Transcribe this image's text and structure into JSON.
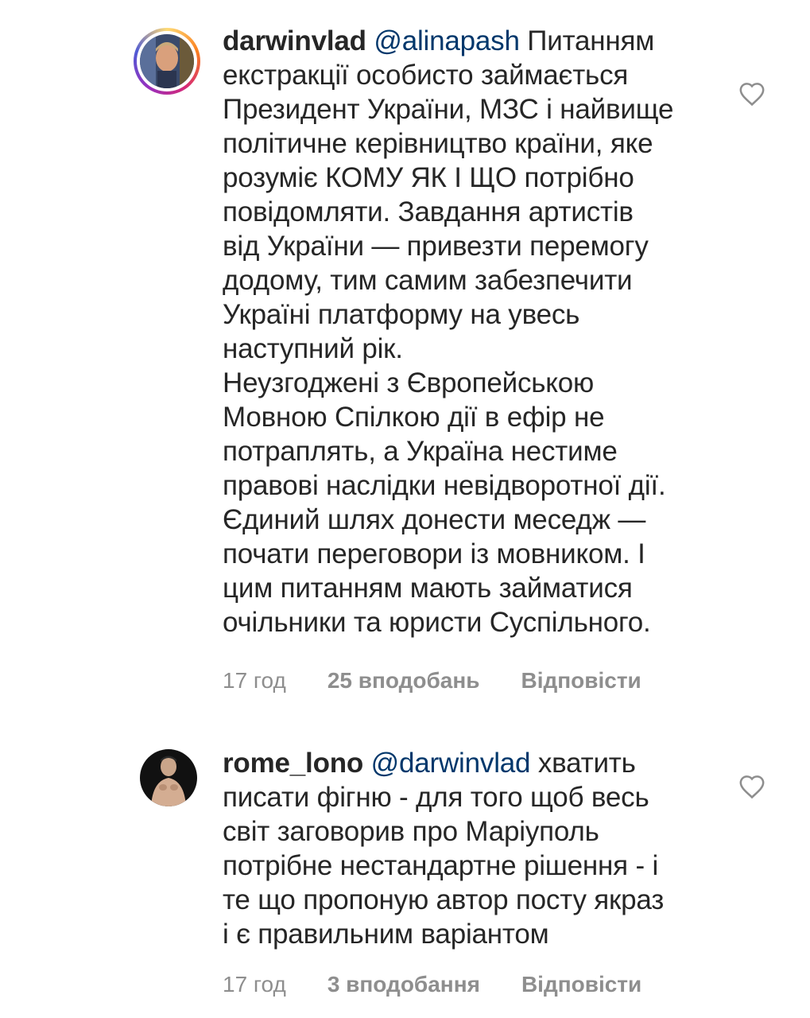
{
  "comments": [
    {
      "username": "darwinvlad",
      "mention": "@alinapash",
      "lines": [
        "Питанням",
        "екстракції особисто займається",
        "Президент України, МЗС і найвище",
        "політичне керівництво країни, яке",
        "розуміє КОМУ ЯК І ЩО потрібно",
        "повідомляти. Завдання артистів",
        "від України — привезти перемогу",
        "додому, тим самим забезпечити",
        "Україні платформу на увесь",
        "наступний рік.",
        "Неузгоджені з Європейською",
        "Мовною Спілкою дії в ефір не",
        "потраплять, а Україна нестиме",
        "правові наслідки невідворотної дії.",
        "Єдиний шлях донести меседж —",
        "почати переговори із мовником. І",
        "цим питанням мають займатися",
        "очільники та юристи Суспільного."
      ],
      "time": "17 год",
      "likes": "25 вподобань",
      "reply": "Відповісти",
      "like_icon": "heart-outline-icon",
      "has_story_ring": true
    },
    {
      "username": "rome_lono",
      "mention": "@darwinvlad",
      "lines": [
        "хватить",
        "писати фігню - для того щоб весь",
        "світ заговорив про Маріуполь",
        "потрібне нестандартне рішення - і",
        "те що пропоную автор посту якраз",
        "і є правильним варіантом"
      ],
      "time": "17 год",
      "likes": "3 вподобання",
      "reply": "Відповісти",
      "like_icon": "heart-outline-icon",
      "has_story_ring": false
    }
  ],
  "colors": {
    "text": "#262626",
    "mention": "#00376b",
    "meta": "#8e8e8e",
    "background": "#ffffff"
  }
}
